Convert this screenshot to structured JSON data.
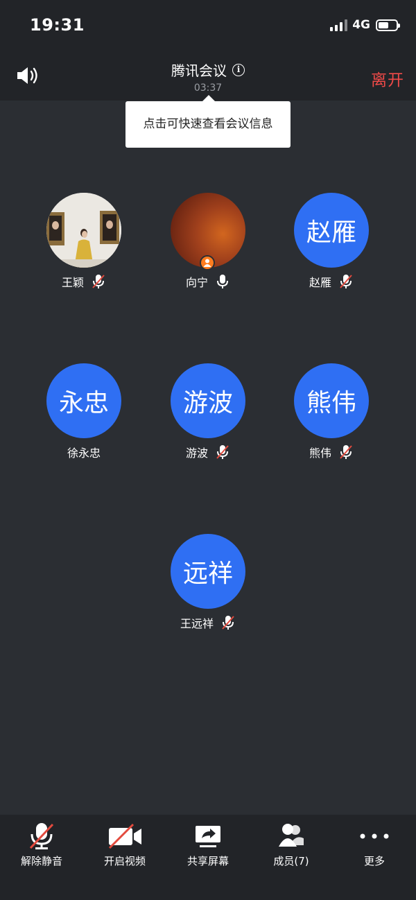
{
  "status_bar": {
    "time": "19:31",
    "network": "4G"
  },
  "header": {
    "title": "腾讯会议",
    "timer": "03:37",
    "leave_label": "离开"
  },
  "tooltip": {
    "text": "点击可快速查看会议信息"
  },
  "participants": [
    {
      "avatar_text": "",
      "name": "王颖",
      "mic": "muted",
      "avatar": "photo-gallery"
    },
    {
      "avatar_text": "",
      "name": "向宁",
      "mic": "on",
      "avatar": "photo-brown"
    },
    {
      "avatar_text": "赵雁",
      "name": "赵雁",
      "mic": "muted"
    },
    {
      "avatar_text": "永忠",
      "name": "徐永忠",
      "mic": "none"
    },
    {
      "avatar_text": "游波",
      "name": "游波",
      "mic": "muted"
    },
    {
      "avatar_text": "熊伟",
      "name": "熊伟",
      "mic": "muted"
    },
    {
      "avatar_text": "远祥",
      "name": "王远祥",
      "mic": "muted"
    }
  ],
  "toolbar": {
    "unmute_label": "解除静音",
    "video_label": "开启视频",
    "share_label": "共享屏幕",
    "members_label": "成员(7)",
    "more_label": "更多"
  },
  "colors": {
    "background": "#2b2e33",
    "bar": "#222428",
    "avatar_blue": "#2f6ff3",
    "leave_red": "#f04a48",
    "muted_slash": "#e34a3e",
    "host_badge": "#ff7d1f"
  }
}
